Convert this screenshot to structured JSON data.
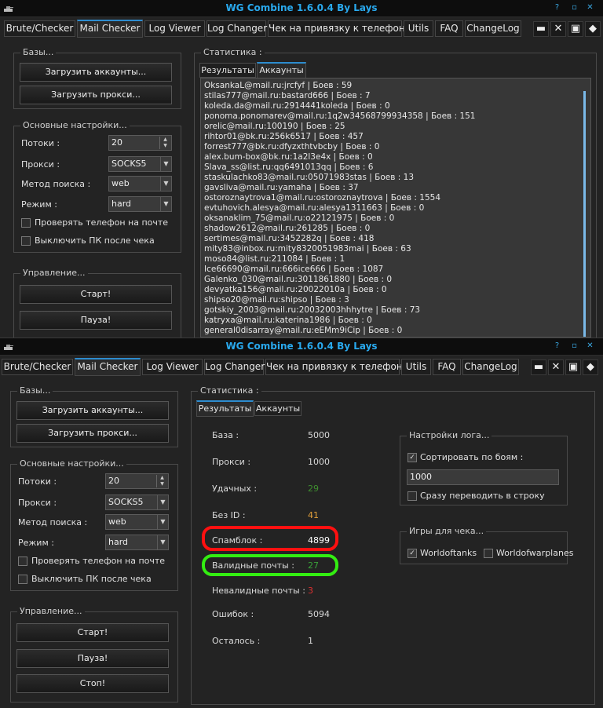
{
  "window": {
    "title": "WG Combine 1.6.0.4 By Lays",
    "controls": {
      "help": "?",
      "minimize": "▫",
      "maximize": "▫",
      "close": "✕"
    }
  },
  "tabs": [
    "Brute/Checker",
    "Mail Checker",
    "Log  Viewer",
    "Log Changer",
    "Чек на привязку к телефону",
    "Utils",
    "FAQ",
    "ChangeLog"
  ],
  "bases": {
    "title": "Базы...",
    "load_accounts": "Загрузить аккаунты...",
    "load_proxies": "Загрузить прокси..."
  },
  "settings": {
    "title": "Основные настройки...",
    "threads_label": "Потоки :",
    "threads_value": "20",
    "proxy_label": "Прокси :",
    "proxy_value": "SOCKS5",
    "method_label": "Метод поиска :",
    "method_value": "web",
    "mode_label": "Режим  :",
    "mode_value": "hard",
    "check_phone": "Проверять телефон на почте",
    "shutdown_pc": "Выключить ПК после чека"
  },
  "control": {
    "title": "Управление...",
    "start": "Старт!",
    "pause": "Пауза!",
    "stop": "Стоп!"
  },
  "stats": {
    "title": "Статистика :",
    "tab_results": "Результаты",
    "tab_accounts": "Аккаунты"
  },
  "accounts": [
    "OksankaL@mail.ru:jrcfyf | Боев : 59",
    "stilas777@mail.ru:bastard666 | Боев : 7",
    "koleda.da@mail.ru:2914441koleda | Боев : 0",
    "ponoma.ponomarev@mail.ru:1q2w34568799934358 | Боев : 151",
    "orelic@mail.ru:100190 | Боев : 25",
    "rihtor01@bk.ru:256k6517 | Боев : 457",
    "forrest777@bk.ru:dfyzxthtvbcby | Боев : 0",
    "alex.bum-box@bk.ru:1a2l3e4x | Боев : 0",
    "Slava_ss@list.ru:qq6491013qq | Боев : 6",
    "staskulachko83@mail.ru:05071983stas | Боев : 13",
    "gavsliva@mail.ru:yamaha | Боев : 37",
    "ostoroznaytrova1@mail.ru:ostoroznaytrova | Боев : 1554",
    "evtuhovich.alesya@mail.ru:alesya1311663 | Боев : 0",
    "oksanaklim_75@mail.ru:o22121975 | Боев : 0",
    "shadow2612@mail.ru:261285 | Боев : 0",
    "sertimes@mail.ru:3452282q | Боев : 418",
    "mity83@inbox.ru:mity8320051983mai | Боев : 63",
    "moso84@list.ru:211084 | Боев : 1",
    "Ice66690@mail.ru:666ice666 | Боев : 1087",
    "Galenko_030@mail.ru:3011861880 | Боев : 0",
    "devyatka156@mail.ru:20022010a | Боев : 0",
    "shipso20@mail.ru:shipso | Боев : 3",
    "gotskiy_2003@mail.ru:20032003hhhytre | Боев : 73",
    "katryxa@mail.ru:katerina1986 | Боев : 0",
    "general0disarray@mail.ru:eEMm9iCip | Боев : 0"
  ],
  "results": [
    {
      "label": "База :",
      "value": "5000",
      "color": "#d8d8d8"
    },
    {
      "label": "Прокси :",
      "value": "1000",
      "color": "#d8d8d8"
    },
    {
      "label": "Удачных :",
      "value": "29",
      "color": "#3f8f2f"
    },
    {
      "label": "Без ID :",
      "value": "41",
      "color": "#e2a03a"
    },
    {
      "label": "Спамблок :",
      "value": "4899",
      "color": "#ffffff"
    },
    {
      "label": "Валидные почты :",
      "value": "27",
      "color": "#39a039"
    },
    {
      "label": "Невалидные почты :",
      "value": "3",
      "color": "#e03030"
    },
    {
      "label": "Ошибок :",
      "value": "5094",
      "color": "#d8d8d8"
    },
    {
      "label": "Осталось :",
      "value": "1",
      "color": "#d8d8d8"
    }
  ],
  "log_settings": {
    "title": "Настройки лога...",
    "sort_by_battles": "Сортировать по боям :",
    "sort_value": "1000",
    "to_line": "Сразу переводить в строку"
  },
  "games": {
    "title": "Игры для чека...",
    "wot": "Worldoftanks",
    "wowp": "Worldofwarplanes"
  },
  "highlight_colors": {
    "red": "#ff1010",
    "green": "#33ee11"
  }
}
